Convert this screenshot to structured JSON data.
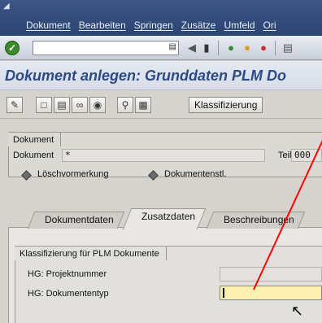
{
  "menu": {
    "items": [
      "Dokument",
      "Bearbeiten",
      "Springen",
      "Zusätze",
      "Umfeld",
      "Ori"
    ]
  },
  "toolbar": {
    "icons": [
      "ok-icon",
      "command-dropdown-icon",
      "back-arrow-icon",
      "save-icon",
      "green-nav-icon",
      "yellow-nav-icon",
      "red-cancel-icon",
      "print-icon"
    ]
  },
  "title": "Dokument anlegen: Grunddaten PLM Do",
  "app_toolbar": {
    "classify_label": "Klassifizierung"
  },
  "document_group": {
    "label": "Dokument",
    "doc_label": "Dokument",
    "doc_value": "*",
    "teil_label": "Teil",
    "teil_value": "000",
    "loesch_label": "Löschvormerkung",
    "dokstl_label": "Dokumentenstl."
  },
  "tabs": [
    "Dokumentdaten",
    "Zusatzdaten",
    "Beschreibungen"
  ],
  "active_tab": "Zusatzdaten",
  "classification": {
    "label": "Klassifizierung für PLM Dokumente",
    "fields": [
      {
        "label": "HG: Projektnummer",
        "value": ""
      },
      {
        "label": "HG: Dokumententyp",
        "value": ""
      }
    ]
  },
  "colors": {
    "menubar": "#2c4472",
    "title": "#2c4b86",
    "active_field": "#fbf0b0",
    "annotation_arrow": "#ff0000"
  }
}
